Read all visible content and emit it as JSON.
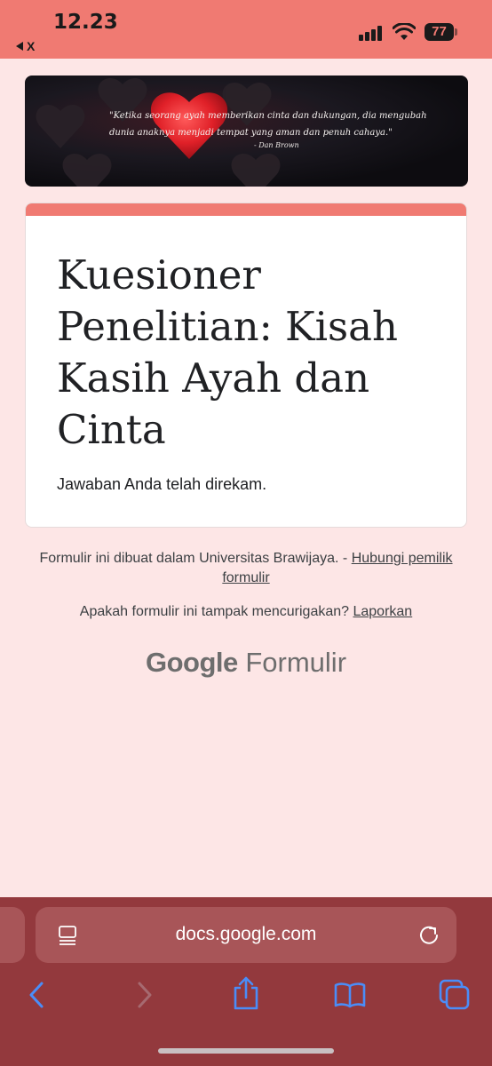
{
  "status_bar": {
    "time": "12.23",
    "back_app": "X",
    "battery": "77"
  },
  "banner": {
    "quote": "\"Ketika seorang ayah memberikan cinta dan dukungan, dia mengubah dunia anaknya menjadi tempat yang aman dan penuh cahaya.\"",
    "author": "- Dan Brown"
  },
  "form": {
    "title": "Kuesioner Penelitian: Kisah Kasih Ayah dan Cinta",
    "confirmation": "Jawaban Anda telah direkam.",
    "accent_color": "#f07a72"
  },
  "footer": {
    "created_in": "Formulir ini dibuat dalam Universitas Brawijaya. - ",
    "contact_link": "Hubungi pemilik formulir",
    "suspicious_text": "Apakah formulir ini tampak mencurigakan? ",
    "report_link": "Laporkan",
    "logo_google": "Google",
    "logo_forms": "Formulir"
  },
  "browser": {
    "url": "docs.google.com",
    "icons": [
      "back-icon",
      "forward-icon",
      "share-icon",
      "bookmarks-icon",
      "tabs-icon",
      "page-menu-icon",
      "reload-icon"
    ],
    "icon_color": "#4a8df8"
  }
}
